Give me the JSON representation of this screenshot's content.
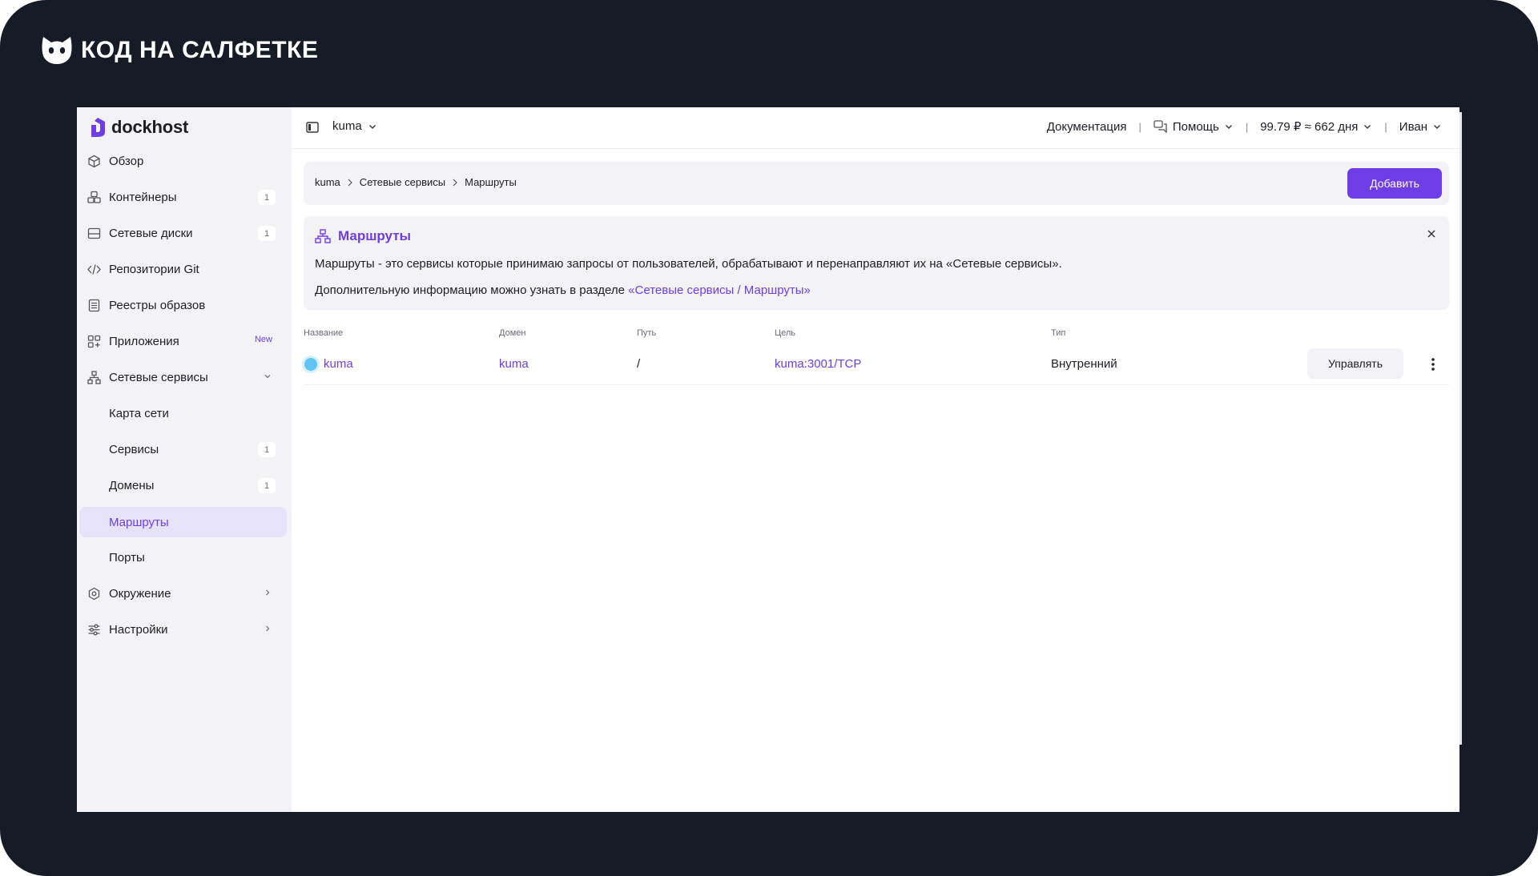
{
  "brand": {
    "text": "КОД НА САЛФЕТКЕ"
  },
  "app": {
    "logo_text": "dockhost"
  },
  "sidebar": {
    "items": [
      {
        "label": "Обзор",
        "icon": "cube-icon"
      },
      {
        "label": "Контейнеры",
        "icon": "containers-icon",
        "badge": "1"
      },
      {
        "label": "Сетевые диски",
        "icon": "disk-icon",
        "badge": "1"
      },
      {
        "label": "Репозитории Git",
        "icon": "code-icon"
      },
      {
        "label": "Реестры образов",
        "icon": "registry-icon"
      },
      {
        "label": "Приложения",
        "icon": "apps-icon",
        "badge": "New"
      },
      {
        "label": "Сетевые сервисы",
        "icon": "network-icon",
        "expanded": true
      },
      {
        "label": "Карта сети"
      },
      {
        "label": "Сервисы",
        "badge": "1"
      },
      {
        "label": "Домены",
        "badge": "1"
      },
      {
        "label": "Маршруты",
        "active": true
      },
      {
        "label": "Порты"
      },
      {
        "label": "Окружение",
        "icon": "gear-icon"
      },
      {
        "label": "Настройки",
        "icon": "sliders-icon"
      }
    ]
  },
  "topbar": {
    "project": "kuma",
    "docs": "Документация",
    "help": "Помощь",
    "balance": "99.79 ₽ ≈ 662 дня",
    "user": "Иван"
  },
  "breadcrumbs": [
    "kuma",
    "Сетевые сервисы",
    "Маршруты"
  ],
  "add_button": "Добавить",
  "info": {
    "title": "Маршруты",
    "line1": "Маршруты - это сервисы которые принимаю запросы от пользователей, обрабатывают и перенаправляют их на «Сетевые сервисы».",
    "line2_prefix": "Дополнительную информацию можно узнать в разделе ",
    "line2_link": "«Сетевые сервисы / Маршруты»"
  },
  "table": {
    "columns": [
      "Название",
      "Домен",
      "Путь",
      "Цель",
      "Тип"
    ],
    "rows": [
      {
        "name": "kuma",
        "domain": "kuma",
        "path": "/",
        "target": "kuma:3001/TCP",
        "type": "Внутренний",
        "action": "Управлять"
      }
    ]
  },
  "colors": {
    "accent": "#6e3de8",
    "frame": "#171b26",
    "sidebar": "#f3f3f7",
    "status": "#5fc5f5"
  }
}
